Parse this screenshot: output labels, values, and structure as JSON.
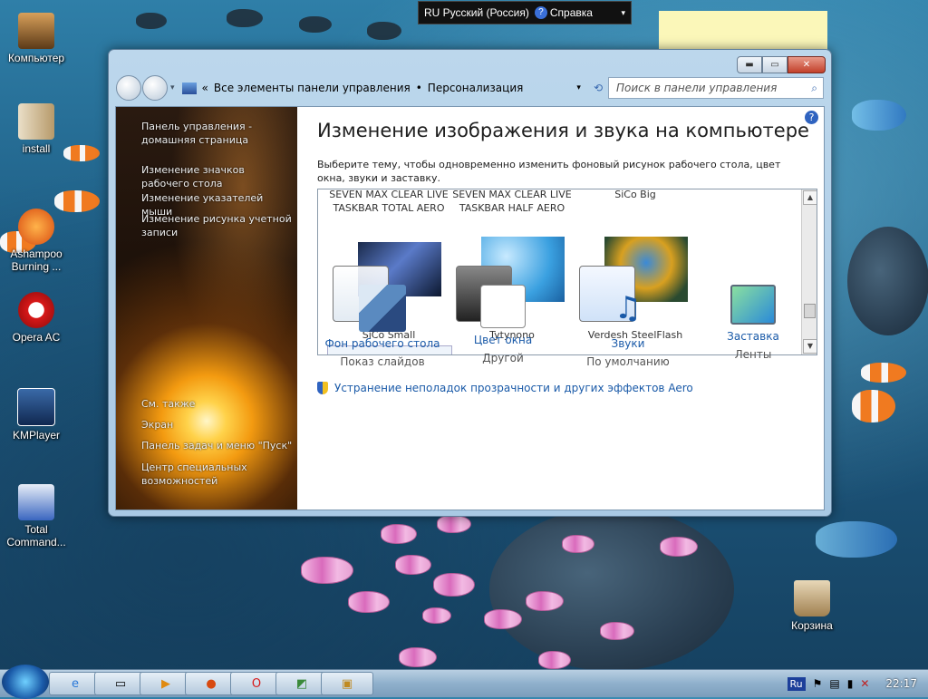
{
  "desktop": {
    "icons": [
      {
        "label": "Компьютер"
      },
      {
        "label": "install"
      },
      {
        "label": "Ashampoo\nBurning ..."
      },
      {
        "label": "Opera AC"
      },
      {
        "label": "KMPlayer"
      },
      {
        "label": "Total\nCommand..."
      },
      {
        "label": "Корзина"
      }
    ]
  },
  "langbar": {
    "lang": "RU Русский (Россия)",
    "help": "Справка"
  },
  "window": {
    "breadcrumb": [
      "Все элементы панели управления",
      "Персонализация"
    ],
    "search_placeholder": "Поиск в панели управления",
    "sidebar": [
      "Панель управления - домашняя страница",
      "Изменение значков рабочего стола",
      "Изменение указателей мыши",
      "Изменение рисунка учетной записи",
      "См. также",
      "Экран",
      "Панель задач и меню \"Пуск\"",
      "Центр специальных возможностей"
    ],
    "title": "Изменение изображения и звука на компьютере",
    "description": "Выберите тему, чтобы одновременно изменить фоновый рисунок рабочего стола, цвет окна, звуки и заставку.",
    "themes_top": [
      "SEVEN MAX CLEAR LIVE TASKBAR TOTAL AERO",
      "SEVEN MAX CLEAR LIVE TASKBAR HALF AERO",
      "SiCo Big"
    ],
    "themes": [
      "SiCo Small",
      "Tytynono",
      "Verdesh SteelFlash"
    ],
    "options": [
      {
        "title": "Фон рабочего стола",
        "sub": "Показ слайдов"
      },
      {
        "title": "Цвет окна",
        "sub": "Другой"
      },
      {
        "title": "Звуки",
        "sub": "По умолчанию"
      },
      {
        "title": "Заставка",
        "sub": "Ленты"
      }
    ],
    "aero_link": "Устранение неполадок прозрачности и других эффектов Aero"
  },
  "taskbar": {
    "clock": "22:17",
    "lang": "Ru"
  }
}
